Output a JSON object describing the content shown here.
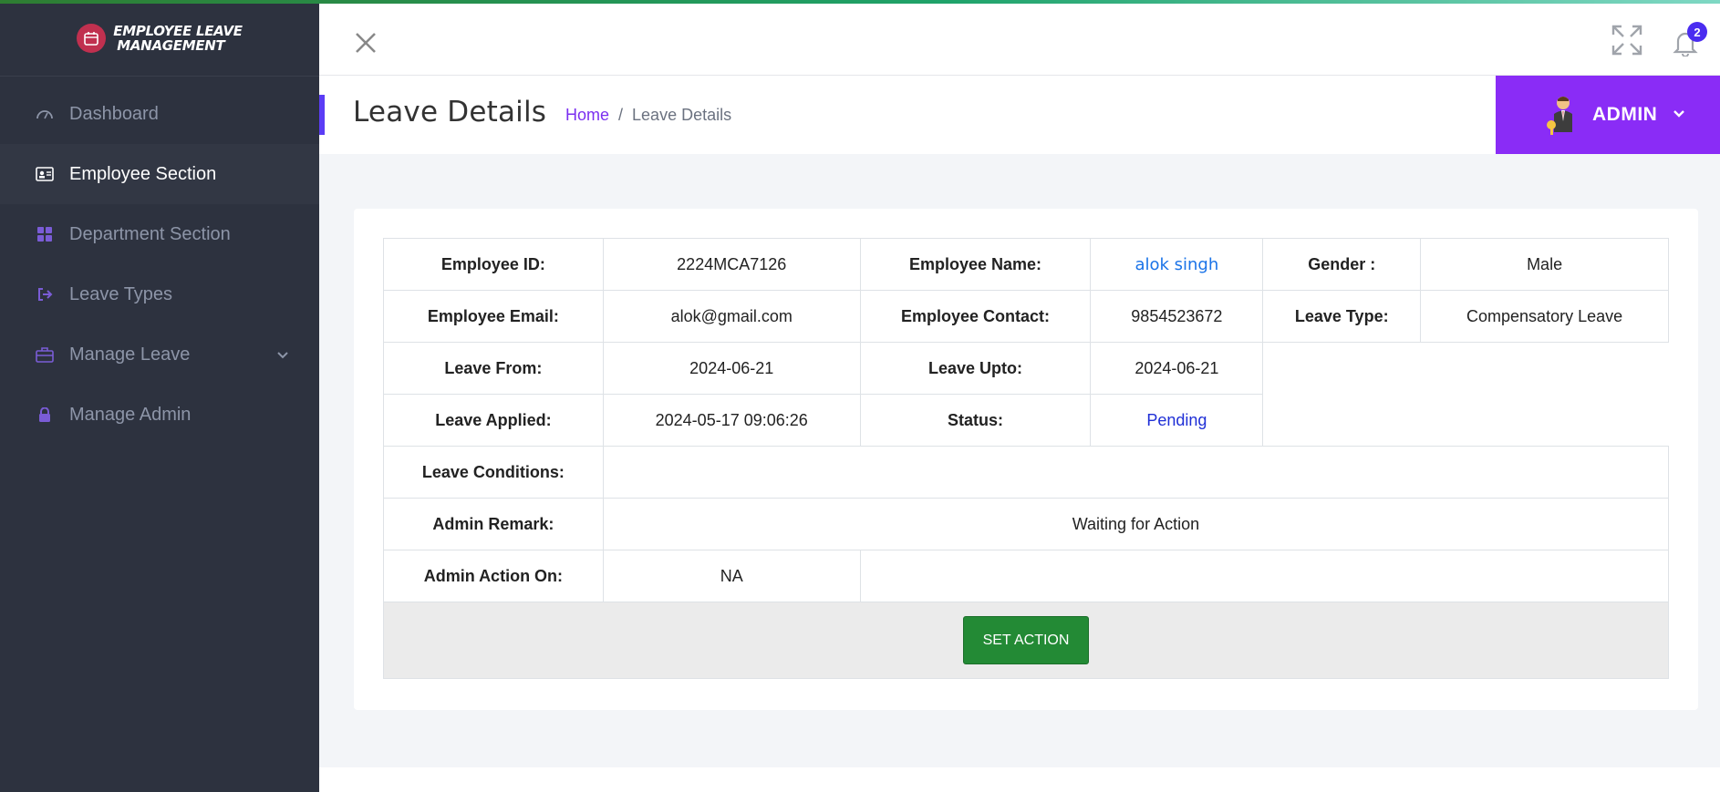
{
  "app": {
    "logo_line1": "Employee Leave",
    "logo_line2": "Management"
  },
  "sidebar": {
    "items": [
      {
        "label": "Dashboard",
        "icon": "dashboard-gauge-icon",
        "active": false
      },
      {
        "label": "Employee Section",
        "icon": "id-card-icon",
        "active": true
      },
      {
        "label": "Department Section",
        "icon": "grid-icon",
        "active": false
      },
      {
        "label": "Leave Types",
        "icon": "sign-out-icon",
        "active": false
      },
      {
        "label": "Manage Leave",
        "icon": "briefcase-icon",
        "active": false,
        "has_submenu": true
      },
      {
        "label": "Manage Admin",
        "icon": "lock-icon",
        "active": false
      }
    ]
  },
  "header": {
    "notification_count": "2"
  },
  "titlebar": {
    "title": "Leave Details",
    "breadcrumb_home": "Home",
    "breadcrumb_sep": "/",
    "breadcrumb_current": "Leave Details",
    "user_label": "ADMIN"
  },
  "details": {
    "employee_id_label": "Employee ID:",
    "employee_id": "2224MCA7126",
    "employee_name_label": "Employee Name:",
    "employee_name": "alok singh",
    "gender_label": "Gender :",
    "gender": "Male",
    "email_label": "Employee Email:",
    "email": "alok@gmail.com",
    "contact_label": "Employee Contact:",
    "contact": "9854523672",
    "leave_type_label": "Leave Type:",
    "leave_type": "Compensatory Leave",
    "leave_from_label": "Leave From:",
    "leave_from": "2024-06-21",
    "leave_upto_label": "Leave Upto:",
    "leave_upto": "2024-06-21",
    "leave_applied_label": "Leave Applied:",
    "leave_applied": "2024-05-17 09:06:26",
    "status_label": "Status:",
    "status": "Pending",
    "conditions_label": "Leave Conditions:",
    "conditions": "",
    "admin_remark_label": "Admin Remark:",
    "admin_remark": "Waiting for Action",
    "admin_action_on_label": "Admin Action On:",
    "admin_action_on": "NA",
    "set_action_label": "SET ACTION"
  },
  "colors": {
    "sidebar_bg": "#2d323f",
    "accent_purple": "#8a2cf6",
    "button_green": "#238a35",
    "link_blue": "#1a73e8",
    "status_pending": "#1f2fd6"
  }
}
